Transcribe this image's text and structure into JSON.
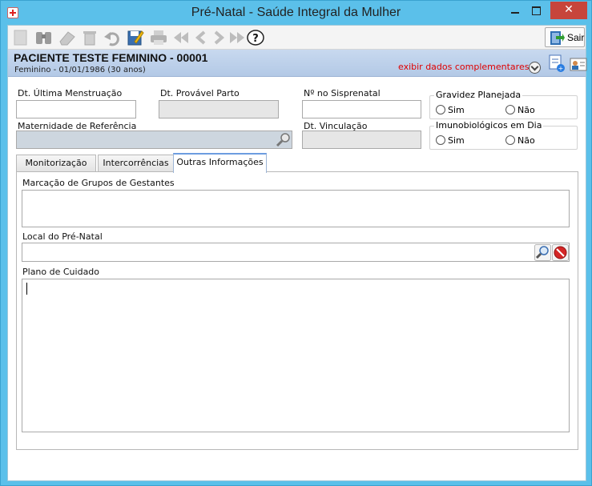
{
  "window": {
    "title": "Pré-Natal - Saúde Integral da Mulher",
    "close_glyph": "✕"
  },
  "toolbar": {
    "buttons": [
      {
        "name": "new-icon"
      },
      {
        "name": "search-binoculars-icon"
      },
      {
        "name": "eraser-icon"
      },
      {
        "name": "trash-icon"
      },
      {
        "name": "undo-icon"
      },
      {
        "name": "save-edit-icon"
      },
      {
        "name": "print-icon"
      },
      {
        "name": "first-record-icon"
      },
      {
        "name": "previous-record-icon"
      },
      {
        "name": "next-record-icon"
      },
      {
        "name": "last-record-icon"
      },
      {
        "name": "help-icon"
      }
    ],
    "exit_label": "Sair"
  },
  "header": {
    "patient_name": "PACIENTE TESTE FEMININO - 00001",
    "patient_info": "Feminino - 01/01/1986 (30 anos)",
    "extra_link": "exibir dados complementares..."
  },
  "form": {
    "last_menstruation_label": "Dt. Última Menstruação",
    "last_menstruation_value": "",
    "probable_birth_label": "Dt. Provável Parto",
    "probable_birth_value": "",
    "sisprenatal_label": "Nº no Sisprenatal",
    "sisprenatal_value": "",
    "planned_pregnancy": {
      "title": "Gravidez Planejada",
      "options": [
        "Sim",
        "Não"
      ]
    },
    "maternity_label": "Maternidade de Referência",
    "maternity_value": "",
    "binding_date_label": "Dt. Vinculação",
    "binding_date_value": "",
    "immunobiologics": {
      "title": "Imunobiológicos em Dia",
      "options": [
        "Sim",
        "Não"
      ]
    }
  },
  "tabs": [
    {
      "label": "Monitorização",
      "active": false
    },
    {
      "label": "Intercorrências",
      "active": false
    },
    {
      "label": "Outras Informações",
      "active": true
    }
  ],
  "panel": {
    "groups_label": "Marcação de Grupos de Gestantes",
    "groups_value": "",
    "local_label": "Local do Pré-Natal",
    "local_value": "",
    "care_plan_label": "Plano de Cuidado",
    "care_plan_value": ""
  }
}
